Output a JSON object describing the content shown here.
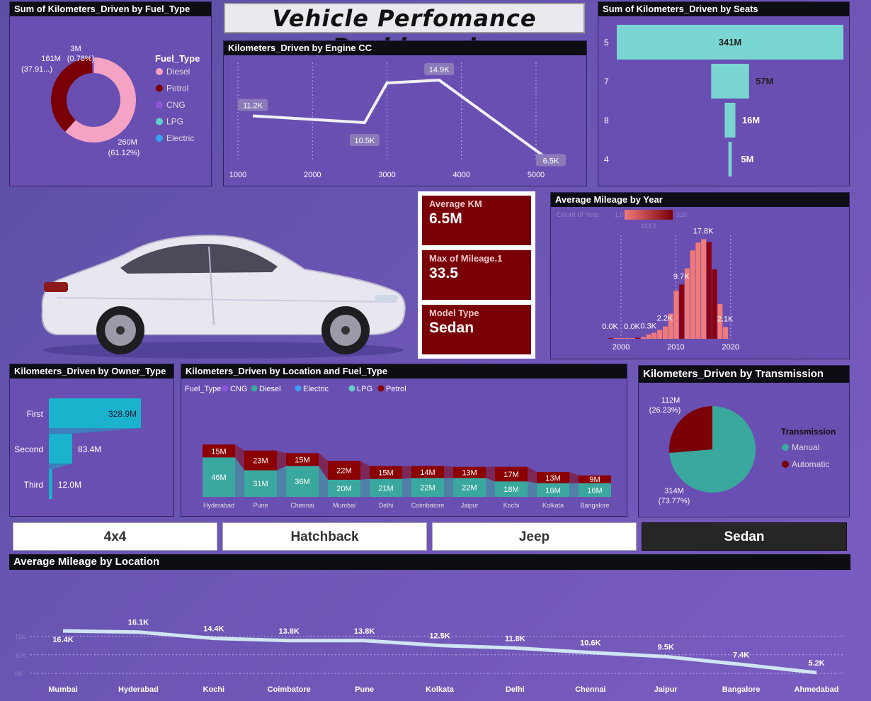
{
  "dashboard": {
    "title": "Vehicle Perfomance Dashboard"
  },
  "fuel_panel": {
    "title": "Sum of Kilometers_Driven by Fuel_Type",
    "legend_title": "Fuel_Type",
    "legend": [
      "Diesel",
      "Petrol",
      "CNG",
      "LPG",
      "Electric"
    ],
    "legend_colors": [
      "#f4a3c4",
      "#7a0008",
      "#8a55d6",
      "#5fd1c8",
      "#3aa0f0"
    ],
    "labels": {
      "top_small_value": "3M",
      "top_small_pct": "(0.78%)",
      "left_value": "161M",
      "left_pct": "(37.91...)",
      "bottom_value": "260M",
      "bottom_pct": "(61.12%)"
    }
  },
  "engine_panel": {
    "title": "Kilometers_Driven by Engine CC",
    "x_ticks": [
      "1000",
      "2000",
      "3000",
      "4000",
      "5000"
    ],
    "point_labels": [
      "11.2K",
      "10.5K",
      "14.9K",
      "6.5K"
    ]
  },
  "seats_panel": {
    "title": "Sum of Kilometers_Driven by Seats",
    "rows": [
      {
        "seat": "5",
        "label": "341M"
      },
      {
        "seat": "7",
        "label": "57M"
      },
      {
        "seat": "8",
        "label": "16M"
      },
      {
        "seat": "4",
        "label": "5M"
      }
    ]
  },
  "kpis": {
    "avg_km_label": "Average KM",
    "avg_km_value": "6.5M",
    "max_mileage_label": "Max of Mileage.1",
    "max_mileage_value": "33.5",
    "model_type_label": "Model Type",
    "model_type_value": "Sedan"
  },
  "year_panel": {
    "title": "Average Mileage by Year",
    "legend_label": "Count of Year",
    "legend_min": "1.0",
    "legend_mid": "163.5",
    "legend_max": "326",
    "x_ticks": [
      "2000",
      "2010",
      "2020"
    ],
    "bar_labels": [
      "0.0K",
      "0.0K",
      "0.3K",
      "2.2K",
      "9.7K",
      "17.8K",
      "2.1K"
    ]
  },
  "owner_panel": {
    "title": "Kilometers_Driven by Owner_Type",
    "rows": [
      {
        "label": "First",
        "value": "328.9M"
      },
      {
        "label": "Second",
        "value": "83.4M"
      },
      {
        "label": "Third",
        "value": "12.0M"
      }
    ]
  },
  "location_fuel_panel": {
    "title": "Kilometers_Driven by Location and Fuel_Type",
    "legend_title": "Fuel_Type",
    "legend": [
      "CNG",
      "Diesel",
      "Electric",
      "LPG",
      "Petrol"
    ],
    "legend_colors": [
      "#8a55d6",
      "#3aa89e",
      "#3aa0f0",
      "#5fd1c8",
      "#8b0000"
    ],
    "cities": [
      "Hyderabad",
      "Pune",
      "Chennai",
      "Mumbai",
      "Delhi",
      "Coimbatore",
      "Jaipur",
      "Kochi",
      "Kolkata",
      "Bangalore"
    ],
    "diesel_labels": [
      "46M",
      "31M",
      "36M",
      "20M",
      "21M",
      "22M",
      "22M",
      "18M",
      "16M",
      "16M"
    ],
    "petrol_labels": [
      "15M",
      "23M",
      "15M",
      "22M",
      "15M",
      "14M",
      "13M",
      "17M",
      "13M",
      "9M"
    ]
  },
  "transmission_panel": {
    "title": "Kilometers_Driven by Transmission",
    "legend_title": "Transmission",
    "legend": [
      "Manual",
      "Automatic"
    ],
    "legend_colors": [
      "#3aa89e",
      "#7a0008"
    ],
    "auto_value": "112M",
    "auto_pct": "(26.23%)",
    "manual_value": "314M",
    "manual_pct": "(73.77%)"
  },
  "slicer": {
    "options": [
      "4x4",
      "Hatchback",
      "Jeep",
      "Sedan"
    ],
    "selected": "Sedan"
  },
  "location_mileage_panel": {
    "title": "Average Mileage by Location",
    "cities": [
      "Mumbai",
      "Hyderabad",
      "Kochi",
      "Coimbatore",
      "Pune",
      "Kolkata",
      "Delhi",
      "Chennai",
      "Jaipur",
      "Bangalore",
      "Ahmedabad"
    ],
    "labels": [
      "16.4K",
      "16.1K",
      "14.4K",
      "13.8K",
      "13.8K",
      "12.5K",
      "11.8K",
      "10.6K",
      "9.5K",
      "7.4K",
      "5.2K"
    ],
    "y_ticks": [
      "15K",
      "10K",
      "5K"
    ]
  },
  "chart_data": [
    {
      "type": "pie",
      "title": "Sum of Kilometers_Driven by Fuel_Type",
      "categories": [
        "Diesel",
        "Petrol",
        "CNG",
        "LPG",
        "Electric"
      ],
      "values": [
        260,
        161,
        3,
        0.4,
        0.1
      ]
    },
    {
      "type": "line",
      "title": "Kilometers_Driven by Engine CC",
      "x": [
        1200,
        2700,
        3000,
        3700,
        5200
      ],
      "values": [
        11.2,
        10.5,
        14.6,
        14.9,
        6.5
      ],
      "xlim": [
        1000,
        5300
      ],
      "ylim": [
        5,
        16
      ]
    },
    {
      "type": "bar",
      "title": "Sum of Kilometers_Driven by Seats",
      "categories": [
        "5",
        "7",
        "8",
        "4"
      ],
      "values": [
        341,
        57,
        16,
        5
      ]
    },
    {
      "type": "bar",
      "title": "Average Mileage by Year",
      "categories": [
        "1998",
        "1999",
        "2000",
        "2001",
        "2002",
        "2003",
        "2004",
        "2005",
        "2006",
        "2007",
        "2008",
        "2009",
        "2010",
        "2011",
        "2012",
        "2013",
        "2014",
        "2015",
        "2016",
        "2017",
        "2018",
        "2019"
      ],
      "values": [
        0.03,
        0.0,
        0.0,
        0.02,
        0.05,
        0.2,
        0.3,
        0.8,
        1.1,
        1.6,
        2.2,
        4.5,
        8.6,
        9.7,
        12.6,
        15.8,
        17.2,
        17.8,
        17.3,
        12.4,
        6.2,
        2.1
      ],
      "ylim": [
        0,
        19
      ]
    },
    {
      "type": "bar",
      "title": "Kilometers_Driven by Owner_Type",
      "categories": [
        "First",
        "Second",
        "Third"
      ],
      "values": [
        328.9,
        83.4,
        12.0
      ]
    },
    {
      "type": "bar",
      "title": "Kilometers_Driven by Location and Fuel_Type",
      "categories": [
        "Hyderabad",
        "Pune",
        "Chennai",
        "Mumbai",
        "Delhi",
        "Coimbatore",
        "Jaipur",
        "Kochi",
        "Kolkata",
        "Bangalore"
      ],
      "series": [
        {
          "name": "Diesel",
          "values": [
            46,
            31,
            36,
            20,
            21,
            22,
            22,
            18,
            16,
            16
          ]
        },
        {
          "name": "Petrol",
          "values": [
            15,
            23,
            15,
            22,
            15,
            14,
            13,
            17,
            13,
            9
          ]
        }
      ],
      "ylim": [
        0,
        70
      ]
    },
    {
      "type": "pie",
      "title": "Kilometers_Driven by Transmission",
      "categories": [
        "Manual",
        "Automatic"
      ],
      "values": [
        314,
        112
      ]
    },
    {
      "type": "line",
      "title": "Average Mileage by Location",
      "categories": [
        "Mumbai",
        "Hyderabad",
        "Kochi",
        "Coimbatore",
        "Pune",
        "Kolkata",
        "Delhi",
        "Chennai",
        "Jaipur",
        "Bangalore",
        "Ahmedabad"
      ],
      "values": [
        16.4,
        16.1,
        14.4,
        13.8,
        13.8,
        12.5,
        11.8,
        10.6,
        9.5,
        7.4,
        5.2
      ],
      "ylim": [
        4,
        19
      ]
    }
  ]
}
